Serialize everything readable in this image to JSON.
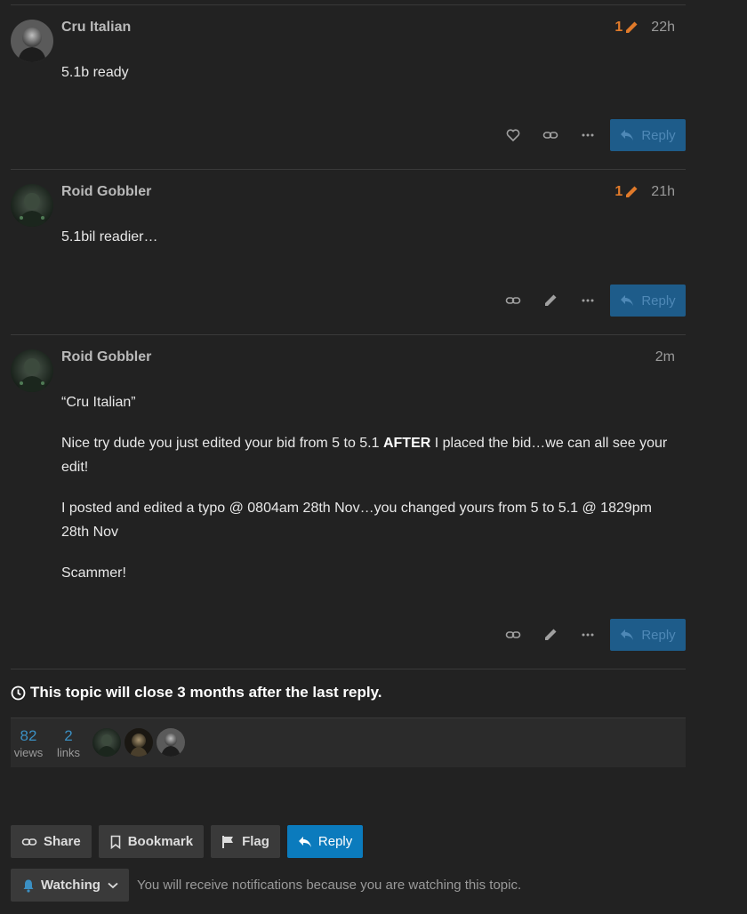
{
  "posts": [
    {
      "username": "Cru Italian",
      "edit_count": "1",
      "time": "22h",
      "paragraphs": [
        "5.1b ready"
      ],
      "actions": [
        "heart-icon",
        "link-icon",
        "more-icon"
      ],
      "reply_label": "Reply"
    },
    {
      "username": "Roid Gobbler",
      "edit_count": "1",
      "time": "21h",
      "paragraphs": [
        "5.1bil readier…"
      ],
      "actions": [
        "link-icon",
        "pencil-icon",
        "more-icon"
      ],
      "reply_label": "Reply"
    },
    {
      "username": "Roid Gobbler",
      "time": "2m",
      "quote": "“Cru Italian”",
      "p2_before": "Nice try dude you just edited your bid from 5 to 5.1 ",
      "p2_bold": "AFTER",
      "p2_after": " I placed the bid…we can all see your edit!",
      "p3": "I posted and edited a typo @ 0804am 28th Nov…you changed yours from 5 to 5.1 @ 1829pm 28th Nov",
      "p4": "Scammer!",
      "actions": [
        "link-icon",
        "pencil-icon",
        "more-icon"
      ],
      "reply_label": "Reply"
    }
  ],
  "close_notice": "This topic will close 3 months after the last reply.",
  "stats": {
    "views_count": "82",
    "views_label": "views",
    "links_count": "2",
    "links_label": "links"
  },
  "footer": {
    "share_label": "Share",
    "bookmark_label": "Bookmark",
    "flag_label": "Flag",
    "reply_label": "Reply",
    "watching_label": "Watching",
    "watching_text": "You will receive notifications because you are watching this topic."
  },
  "colors": {
    "background": "#222222",
    "edit_badge": "#e07a2a",
    "reply_button": "#1e5c8a",
    "primary_button": "#0b7bbd",
    "link_blue": "#3b8fc2"
  }
}
